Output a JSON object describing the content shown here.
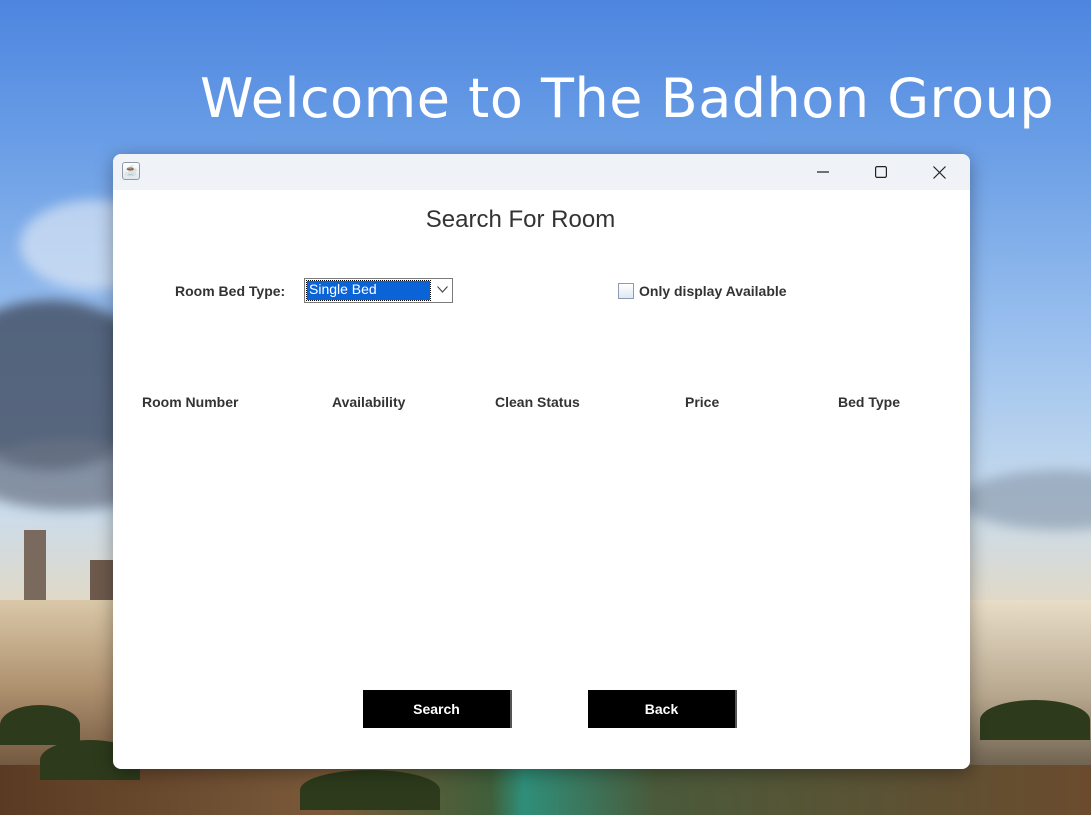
{
  "background": {
    "heading": "Welcome to The Badhon Group"
  },
  "window": {
    "titlebar": {
      "app_icon": "java-cup-icon",
      "controls": [
        "minimize-icon",
        "maximize-icon",
        "close-icon"
      ]
    },
    "title": "Search For Room",
    "filter": {
      "bed_type_label": "Room Bed Type:",
      "bed_type_selected": "Single Bed",
      "available_label": "Only display Available",
      "available_checked": false
    },
    "table": {
      "columns": [
        "Room Number",
        "Availability",
        "Clean Status",
        "Price",
        "Bed Type"
      ],
      "rows": []
    },
    "buttons": {
      "search": "Search",
      "back": "Back"
    }
  }
}
